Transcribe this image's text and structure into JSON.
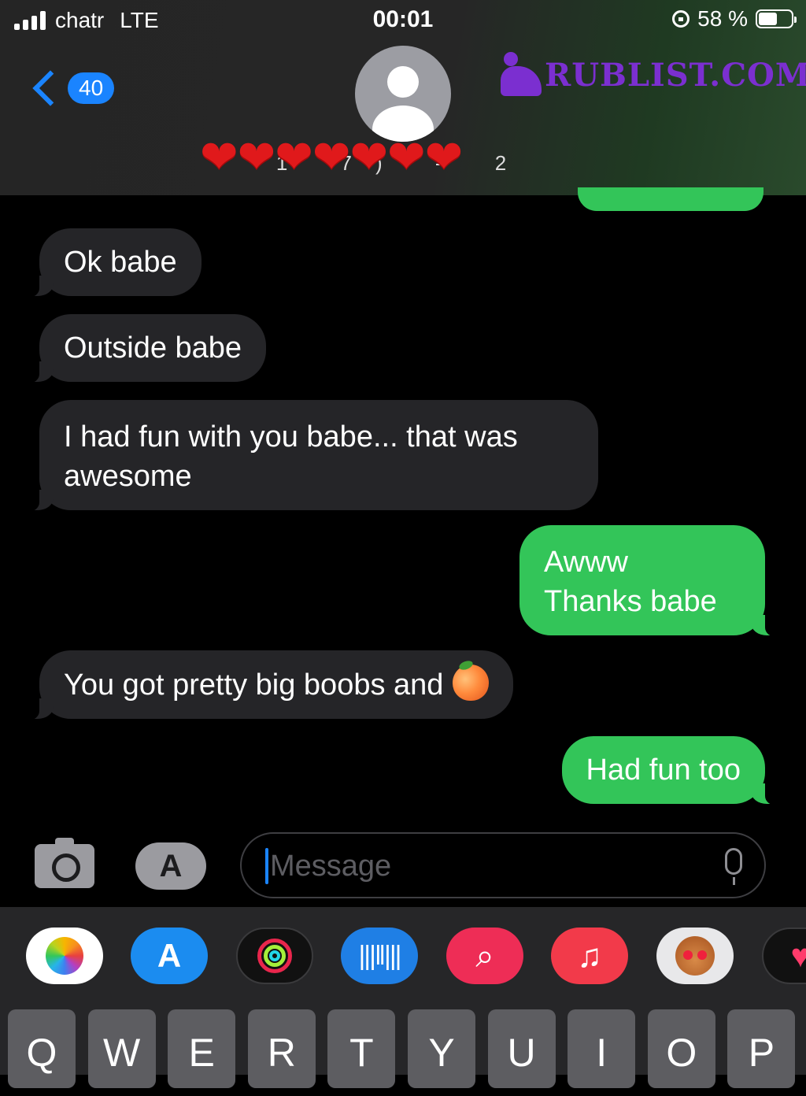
{
  "status_bar": {
    "carrier": "chatr",
    "network": "LTE",
    "time": "00:01",
    "battery": "58 %",
    "battery_level": 0.58
  },
  "header": {
    "back_count": "40",
    "contact_number": "1 7) - 2",
    "watermark": "RUBLIST.COM",
    "hearts": [
      "❤",
      "❤",
      "❤",
      "❤",
      "❤",
      "❤",
      "❤"
    ]
  },
  "messages": [
    {
      "direction": "in",
      "lines": [
        "Ok babe"
      ]
    },
    {
      "direction": "in",
      "lines": [
        "Outside babe"
      ]
    },
    {
      "direction": "in",
      "lines": [
        "I had fun with you babe... that was",
        "awesome"
      ]
    },
    {
      "direction": "out",
      "lines": [
        "Awww",
        "Thanks babe"
      ]
    },
    {
      "direction": "in",
      "lines": [
        "You got pretty big boobs and"
      ],
      "emoji": "peach"
    },
    {
      "direction": "out",
      "lines": [
        "Had fun too"
      ]
    }
  ],
  "composer": {
    "placeholder": "Message",
    "camera_icon": "camera-icon",
    "appstore_icon": "app-store-icon",
    "mic_icon": "microphone-icon"
  },
  "app_drawer": [
    "photos",
    "app-store",
    "activity",
    "soundhound",
    "image-search",
    "music",
    "memoji",
    "more"
  ],
  "keyboard": {
    "row1": [
      "Q",
      "W",
      "E",
      "R",
      "T",
      "Y",
      "U",
      "I",
      "O",
      "P"
    ]
  },
  "colors": {
    "sent_bubble": "#33c559",
    "received_bubble": "#252528",
    "accent": "#1a84ff",
    "watermark": "#7b2fd0",
    "heart": "#e0191b"
  }
}
